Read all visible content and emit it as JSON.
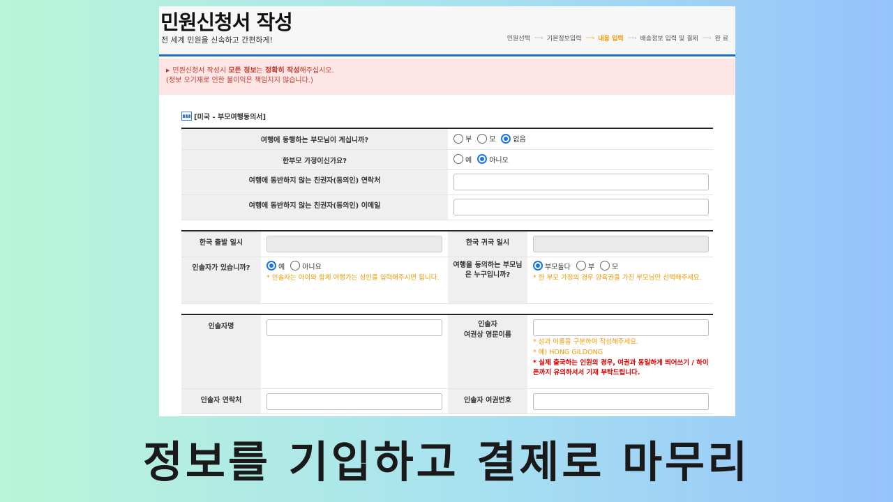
{
  "header": {
    "title": "민원신청서 작성",
    "subtitle": "전 세계 민원을 신속하고 간편하게!",
    "steps": [
      "민원선택",
      "기본정보입력",
      "내용 입력",
      "배송정보 입력 및 결제",
      "완 료"
    ],
    "step_arrow": "·····›",
    "current_step": 2
  },
  "notice": {
    "bullet": "▶",
    "line1_pre": "민원신청서 작성시 ",
    "line1_bold1": "모든 정보",
    "line1_mid": "는 ",
    "line1_bold2": "정확히 작성",
    "line1_post": "해주십시오.",
    "line2": "(정보 오기재로 인한 불이익은 책임지지 않습니다.)"
  },
  "section": {
    "title": "[미국 - 부모여행동의서]",
    "icon": "people-icon"
  },
  "parent_table": {
    "q_accompany": "여행에 동행하는 부모님이 계십니까?",
    "q_accompany_options": [
      "부",
      "모",
      "없음"
    ],
    "q_single": "한부모 가정이신가요?",
    "q_single_options": [
      "예",
      "아니오"
    ],
    "q_contact": "여행에 동반하지 않는 친권자(동의인) 연락처",
    "q_email": "여행에 동반하지 않는 친권자(동의인) 이메일"
  },
  "travel_table": {
    "depart_label": "한국 출발 일시",
    "return_label": "한국 귀국 일시",
    "guardian_q": "인솔자가 있습니까?",
    "guardian_options": [
      "예",
      "아니요"
    ],
    "guardian_hint": "* 인솔자는 아이와 함께 여행가는 성인을 입력해주시면 됩니다.",
    "consent_q": "여행을 동의하는 부모님은 누구입니까?",
    "consent_options": [
      "부모둘다",
      "부",
      "모"
    ],
    "consent_hint": "* 한 부모 가정의 경우 양육권을 가진 부모님만 선택해주세요."
  },
  "guardian_table": {
    "name_label": "인솔자명",
    "eng_name_label_1": "인솔자",
    "eng_name_label_2": "여권상 영문이름",
    "hint1": "* 성과 이름을 구분하여 작성해주세요.",
    "hint2": "* 예) HONG GILDONG",
    "hint3": "* 실제 출국하는 인원의 경우, 여권과 동일하게 띄어쓰기 / 하이픈까지 유의하셔서 기재 부탁드립니다.",
    "contact_label": "인솔자 연락처",
    "passport_label": "인솔자 여권번호"
  },
  "caption": "정보를 기입하고 결제로 마무리",
  "colors": {
    "accent": "#1a6fbf",
    "step_active": "#f39800",
    "notice_bg": "#fde6e5",
    "notice_text": "#c0392b",
    "radio": "#1a73e8"
  }
}
